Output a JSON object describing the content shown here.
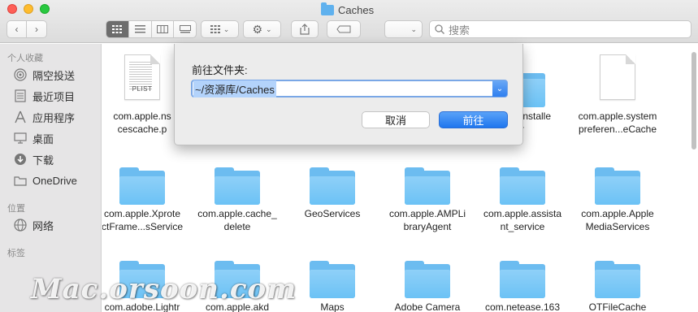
{
  "window": {
    "title": "Caches",
    "search_placeholder": "搜索"
  },
  "sidebar": {
    "sections": [
      {
        "title": "个人收藏"
      },
      {
        "title": "位置"
      },
      {
        "title": "标签"
      }
    ],
    "favorites": [
      {
        "label": "隔空投送",
        "icon": "airdrop-icon"
      },
      {
        "label": "最近项目",
        "icon": "recents-icon"
      },
      {
        "label": "应用程序",
        "icon": "applications-icon"
      },
      {
        "label": "桌面",
        "icon": "desktop-icon"
      },
      {
        "label": "下载",
        "icon": "downloads-icon"
      },
      {
        "label": "OneDrive",
        "icon": "folder-icon"
      }
    ],
    "locations": [
      {
        "label": "网络",
        "icon": "network-icon"
      }
    ]
  },
  "files": [
    {
      "label": "com.apple.ns\ncescache.p",
      "kind": "doc",
      "tag": "PLIST"
    },
    {
      "label": "",
      "kind": "hidden"
    },
    {
      "label": "",
      "kind": "hidden"
    },
    {
      "label": "",
      "kind": "hidden"
    },
    {
      "label": "apple.installe\nr",
      "kind": "folder"
    },
    {
      "label": "com.apple.system\npreferen...eCache",
      "kind": "doc",
      "tag": ""
    },
    {
      "label": "com.apple.Xprote\nctFrame...sService",
      "kind": "folder"
    },
    {
      "label": "com.apple.cache_\ndelete",
      "kind": "folder"
    },
    {
      "label": "GeoServices",
      "kind": "folder"
    },
    {
      "label": "com.apple.AMPLi\nbraryAgent",
      "kind": "folder"
    },
    {
      "label": "com.apple.assista\nnt_service",
      "kind": "folder"
    },
    {
      "label": "com.apple.Apple\nMediaServices",
      "kind": "folder"
    },
    {
      "label": "com.adobe.Lightr",
      "kind": "folder"
    },
    {
      "label": "com.apple.akd",
      "kind": "folder"
    },
    {
      "label": "Maps",
      "kind": "folder"
    },
    {
      "label": "Adobe Camera",
      "kind": "folder"
    },
    {
      "label": "com.netease.163",
      "kind": "folder"
    },
    {
      "label": "OTFileCache",
      "kind": "folder"
    }
  ],
  "dialog": {
    "label": "前往文件夹:",
    "path_value": "~/资源库/Caches",
    "cancel_label": "取消",
    "go_label": "前往"
  },
  "watermark": "Mac.orsoon.com",
  "colors": {
    "folder": "#6cbcf0",
    "accent": "#2f7fef"
  }
}
